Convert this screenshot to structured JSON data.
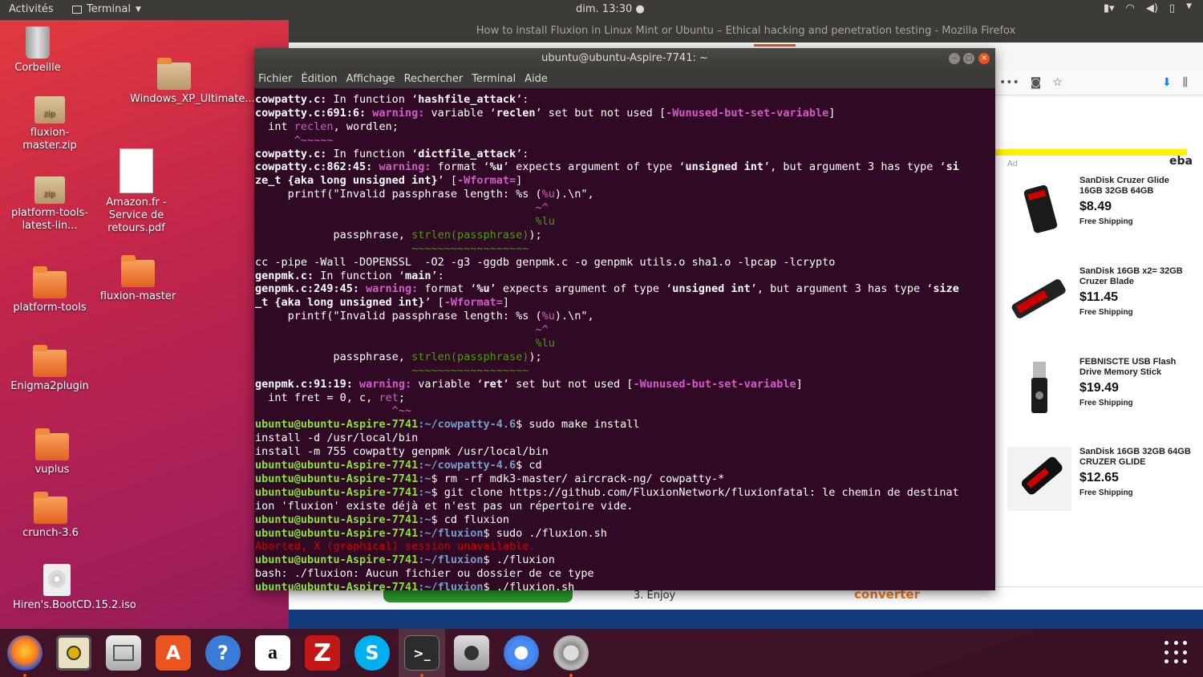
{
  "topbar": {
    "activities": "Activités",
    "app_menu": "Terminal",
    "clock": "dim. 13:30"
  },
  "firefox": {
    "title": "How to install Fluxion in Linux Mint or Ubuntu – Ethical hacking and penetration testing - Mozilla Firefox",
    "page_bottom_text": "3. Enjoy",
    "page_bottom_brand": "converter",
    "ad": {
      "label": "Ad",
      "brand": "eba",
      "products": [
        {
          "name": "SanDisk Cruzer Glide 16GB 32GB 64GB",
          "price": "$8.49",
          "shipping": "Free Shipping"
        },
        {
          "name": "SanDisk 16GB x2= 32GB Cruzer Blade",
          "price": "$11.45",
          "shipping": "Free Shipping"
        },
        {
          "name": "FEBNISCTE USB Flash Drive Memory Stick",
          "price": "$19.49",
          "shipping": "Free Shipping"
        },
        {
          "name": "SanDisk 16GB 32GB 64GB CRUZER GLIDE",
          "price": "$12.65",
          "shipping": "Free Shipping"
        }
      ]
    }
  },
  "terminal": {
    "title": "ubuntu@ubuntu-Aspire-7741: ~",
    "menu": [
      "Fichier",
      "Édition",
      "Affichage",
      "Rechercher",
      "Terminal",
      "Aide"
    ],
    "prompt_user": "ubuntu@ubuntu-Aspire-7741",
    "lines": {
      "l1a": "cowpatty.c:",
      "l1b": " In function ‘",
      "l1c": "hashfile_attack",
      "l1d": "’:",
      "l2a": "cowpatty.c:691:6:",
      "l2b": " warning:",
      "l2c": " variable ‘",
      "l2d": "reclen",
      "l2e": "’ set but not used [",
      "l2f": "-Wunused-but-set-variable",
      "l2g": "]",
      "l3a": "  int ",
      "l3b": "reclen",
      "l3c": ", wordlen;",
      "l4": "      ^~~~~~",
      "l5a": "cowpatty.c:",
      "l5b": " In function ‘",
      "l5c": "dictfile_attack",
      "l5d": "’:",
      "l6a": "cowpatty.c:862:45:",
      "l6b": " warning:",
      "l6c": " format ‘",
      "l6d": "%u",
      "l6e": "’ expects argument of type ‘",
      "l6f": "unsigned int",
      "l6g": "’, but argument 3 has type ‘",
      "l6h": "si",
      "l7a": "ze_t {aka long unsigned int}",
      "l7b": "’ [",
      "l7c": "-Wformat=",
      "l7d": "]",
      "l8a": "     printf(\"Invalid passphrase length: %s (",
      "l8b": "%u",
      "l8c": ").\\n\",",
      "l9": "                                           ~^",
      "l10": "                                           %lu",
      "l11a": "            passphrase, ",
      "l11b": "strlen(passphrase)",
      "l11c": ");",
      "l12": "                        ~~~~~~~~~~~~~~~~~~",
      "l13": "cc -pipe -Wall -DOPENSSL  -O2 -g3 -ggdb genpmk.c -o genpmk utils.o sha1.o -lpcap -lcrypto",
      "l14a": "genpmk.c:",
      "l14b": " In function ‘",
      "l14c": "main",
      "l14d": "’:",
      "l15a": "genpmk.c:249:45:",
      "l15b": " warning:",
      "l15c": " format ‘",
      "l15d": "%u",
      "l15e": "’ expects argument of type ‘",
      "l15f": "unsigned int",
      "l15g": "’, but argument 3 has type ‘",
      "l15h": "size",
      "l16a": "_t {aka long unsigned int}",
      "l16b": "’ [",
      "l16c": "-Wformat=",
      "l16d": "]",
      "l17a": "     printf(\"Invalid passphrase length: %s (",
      "l17b": "%u",
      "l17c": ").\\n\",",
      "l18": "                                           ~^",
      "l19": "                                           %lu",
      "l20a": "            passphrase, ",
      "l20b": "strlen(passphrase)",
      "l20c": ");",
      "l21": "                        ~~~~~~~~~~~~~~~~~~",
      "l22a": "genpmk.c:91:19:",
      "l22b": " warning:",
      "l22c": " variable ‘",
      "l22d": "ret",
      "l22e": "’ set but not used [",
      "l22f": "-Wunused-but-set-variable",
      "l22g": "]",
      "l23a": "  int fret = 0, c, ",
      "l23b": "ret",
      "l23c": ";",
      "l24": "                     ^~~",
      "l25path": ":~/cowpatty-4.6",
      "l25cmd": "$ sudo make install",
      "l26": "install -d /usr/local/bin",
      "l27": "install -m 755 cowpatty genpmk /usr/local/bin",
      "l28path": ":~/cowpatty-4.6",
      "l28cmd": "$ cd",
      "l29path": ":~",
      "l29cmd": "$ rm -rf mdk3-master/ aircrack-ng/ cowpatty-*",
      "l30path": ":~",
      "l30cmd": "$ git clone https://github.com/FluxionNetwork/fluxionfatal: le chemin de destinat",
      "l31": "ion 'fluxion' existe déjà et n'est pas un répertoire vide.",
      "l32path": ":~",
      "l32cmd": "$ cd fluxion",
      "l33path": ":~/fluxion",
      "l33cmd": "$ sudo ./fluxion.sh",
      "l34": "Aborted, X (graphical) session unavailable.",
      "l35path": ":~/fluxion",
      "l35cmd": "$ ./fluxion",
      "l36": "bash: ./fluxion: Aucun fichier ou dossier de ce type",
      "l37path": ":~/fluxion",
      "l37cmd": "$ ./fluxion.sh"
    }
  },
  "desktop_icons": [
    {
      "label": "Corbeille",
      "icon": "trash-icon"
    },
    {
      "label": "fluxion-master.zip",
      "icon": "zip-icon"
    },
    {
      "label": "Windows_XP_Ultimate...",
      "icon": "folder-icon"
    },
    {
      "label": "Amazon.fr - Service de retours.pdf",
      "icon": "pdf-icon"
    },
    {
      "label": "platform-tools-latest-lin...",
      "icon": "zip-icon"
    },
    {
      "label": "platform-tools",
      "icon": "folder-icon"
    },
    {
      "label": "fluxion-master",
      "icon": "folder-icon"
    },
    {
      "label": "Enigma2plugin",
      "icon": "folder-icon"
    },
    {
      "label": "vuplus",
      "icon": "folder-icon"
    },
    {
      "label": "crunch-3.6",
      "icon": "folder-icon"
    },
    {
      "label": "Hiren's.BootCD.15.2.iso",
      "icon": "iso-icon"
    }
  ],
  "dock": [
    "firefox",
    "rhythmbox",
    "files",
    "software",
    "help",
    "amazon",
    "filezilla",
    "skype",
    "terminal",
    "screenshot",
    "chromium",
    "settings"
  ]
}
